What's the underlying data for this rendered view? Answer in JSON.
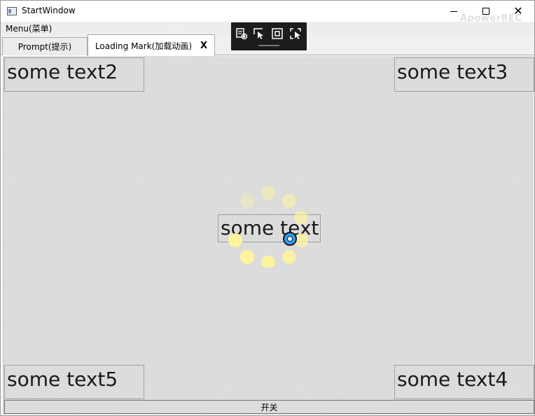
{
  "window": {
    "title": "StartWindow",
    "watermark": "ApowerREC"
  },
  "menu": {
    "items": [
      {
        "label": "Menu(菜单)"
      }
    ]
  },
  "tabs": [
    {
      "label": "Prompt(提示)",
      "selected": false
    },
    {
      "label": "Loading Mark(加载动画)",
      "selected": true,
      "close_label": "X"
    }
  ],
  "content": {
    "texts": {
      "center": "some text",
      "top_left": "some text2",
      "top_right": "some text3",
      "bottom_right": "some text4",
      "bottom_left": "some text5"
    },
    "toggle_button": "开关",
    "spinner_color": "#fff59a"
  }
}
